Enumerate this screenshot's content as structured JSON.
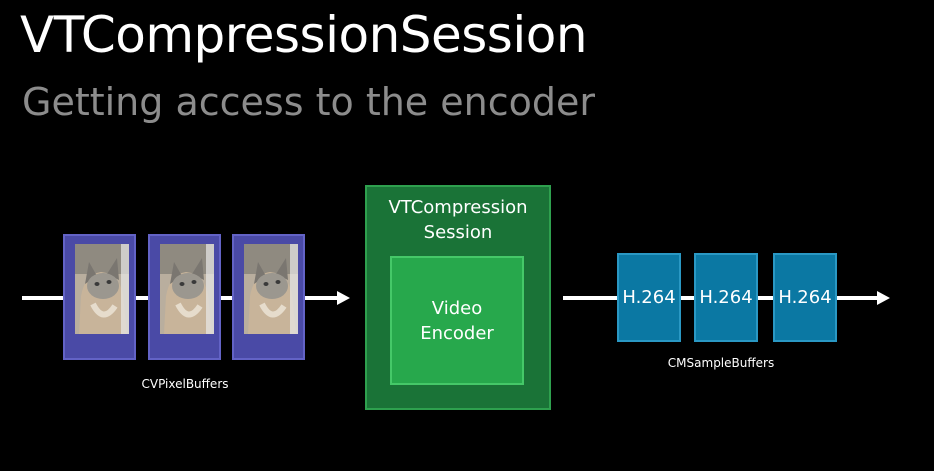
{
  "slide": {
    "title": "VTCompressionSession",
    "subtitle": "Getting access to the encoder"
  },
  "diagram": {
    "input_caption": "CVPixelBuffers",
    "input_buffer_count": 3,
    "input_image": "cat-photo",
    "session_label_line1": "VTCompression",
    "session_label_line2": "Session",
    "encoder_label_line1": "Video",
    "encoder_label_line2": "Encoder",
    "output_labels": [
      "H.264",
      "H.264",
      "H.264"
    ],
    "output_caption": "CMSampleBuffers"
  },
  "colors": {
    "background": "#000000",
    "pixel_buffer": "#4a4aa6",
    "session": "#1a7337",
    "encoder": "#27a84c",
    "sample_buffer": "#0b78a3",
    "subtitle": "#8c8c8c"
  }
}
